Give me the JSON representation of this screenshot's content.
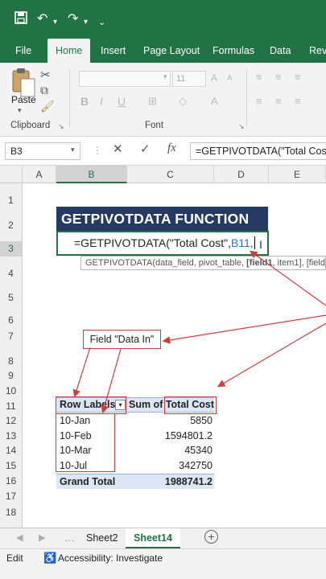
{
  "ribbon": {
    "tabs": [
      "File",
      "Home",
      "Insert",
      "Page Layout",
      "Formulas",
      "Data",
      "Revi"
    ],
    "active_tab": "Home",
    "paste_label": "Paste",
    "clipboard_label": "Clipboard",
    "font_label": "Font",
    "font_size": "11"
  },
  "formula_bar": {
    "name_box": "B3",
    "fx": "fx",
    "formula": "=GETPIVOTDATA(\"Total Cos"
  },
  "columns": [
    "A",
    "B",
    "C",
    "D",
    "E"
  ],
  "rows": [
    "1",
    "2",
    "3",
    "4",
    "5",
    "6",
    "7",
    "8",
    "9",
    "10",
    "11",
    "12",
    "13",
    "14",
    "15",
    "16",
    "17",
    "18"
  ],
  "sheet": {
    "banner": "GETPIVOTDATA  FUNCTION",
    "formula_cell_prefix": "=GETPIVOTDATA(\"Total Cost\",",
    "formula_cell_ref": "B11,",
    "tooltip_prefix": "GETPIVOTDATA(data_field, pivot_table, ",
    "tooltip_bold": "[field1",
    "tooltip_suffix": ", item1], [field",
    "callout": "Field \"Data In\"",
    "pivot": {
      "header_labels": "Row Labels",
      "header_sum": "Sum of Total Cost",
      "rows": [
        {
          "label": "10-Jan",
          "value": "5850"
        },
        {
          "label": "10-Feb",
          "value": "1594801.2"
        },
        {
          "label": "10-Mar",
          "value": "45340"
        },
        {
          "label": "10-Jul",
          "value": "342750"
        }
      ],
      "total_label": "Grand Total",
      "total_value": "1988741.2"
    }
  },
  "sheet_tabs": [
    "Sheet2",
    "Sheet14"
  ],
  "active_sheet": "Sheet14",
  "status": {
    "mode": "Edit",
    "accessibility": "Accessibility: Investigate"
  },
  "colors": {
    "excel_green": "#217346",
    "banner_navy": "#253a63",
    "annotation_red": "#d23c3c",
    "pivot_header": "#dce6f4"
  }
}
